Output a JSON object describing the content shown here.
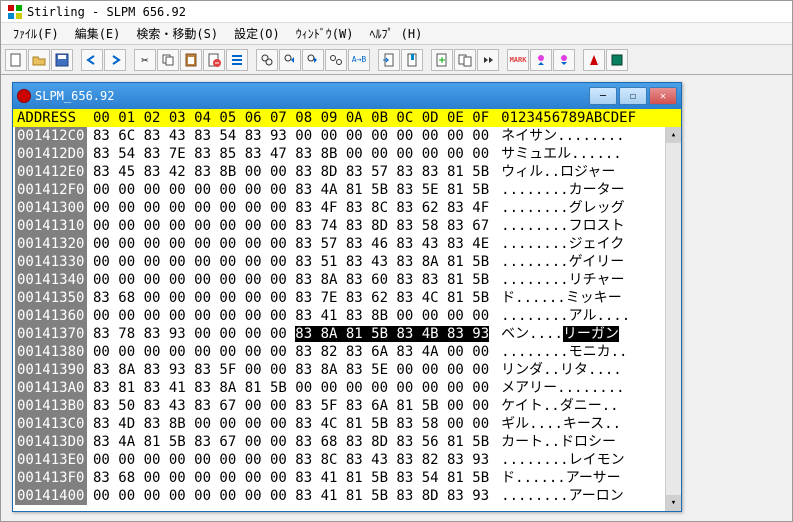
{
  "app": {
    "title": "Stirling - SLPM 656.92"
  },
  "menu": {
    "file": "ﾌｧｲﾙ(F)",
    "edit": "編集(E)",
    "search": "検索・移動(S)",
    "settings": "設定(O)",
    "window": "ｳｨﾝﾄﾞｳ(W)",
    "help": "ﾍﾙﾌﾟ (H)"
  },
  "doc": {
    "title": "SLPM_656.92"
  },
  "header": {
    "addr": "ADDRESS",
    "cols": "00 01 02 03 04 05 06 07 08 09 0A 0B 0C 0D 0E 0F",
    "asc": "0123456789ABCDEF"
  },
  "rows": [
    {
      "a": "001412C0",
      "h": "83 6C 83 43 83 54 83 93 00 00 00 00 00 00 00 00",
      "t": "ネイサン........"
    },
    {
      "a": "001412D0",
      "h": "83 54 83 7E 83 85 83 47 83 8B 00 00 00 00 00 00",
      "t": "サミュエル......"
    },
    {
      "a": "001412E0",
      "h": "83 45 83 42 83 8B 00 00 83 8D 83 57 83 83 81 5B",
      "t": "ウィル..ロジャー"
    },
    {
      "a": "001412F0",
      "h": "00 00 00 00 00 00 00 00 83 4A 81 5B 83 5E 81 5B",
      "t": "........カーター"
    },
    {
      "a": "00141300",
      "h": "00 00 00 00 00 00 00 00 83 4F 83 8C 83 62 83 4F",
      "t": "........グレッグ"
    },
    {
      "a": "00141310",
      "h": "00 00 00 00 00 00 00 00 83 74 83 8D 83 58 83 67",
      "t": "........フロスト"
    },
    {
      "a": "00141320",
      "h": "00 00 00 00 00 00 00 00 83 57 83 46 83 43 83 4E",
      "t": "........ジェイク"
    },
    {
      "a": "00141330",
      "h": "00 00 00 00 00 00 00 00 83 51 83 43 83 8A 81 5B",
      "t": "........ゲイリー"
    },
    {
      "a": "00141340",
      "h": "00 00 00 00 00 00 00 00 83 8A 83 60 83 83 81 5B",
      "t": "........リチャー"
    },
    {
      "a": "00141350",
      "h": "83 68 00 00 00 00 00 00 83 7E 83 62 83 4C 81 5B",
      "t": "ド......ミッキー"
    },
    {
      "a": "00141360",
      "h": "00 00 00 00 00 00 00 00 83 41 83 8B 00 00 00 00",
      "t": "........アル...."
    },
    {
      "a": "00141370",
      "h": "83 78 83 93 00 00 00 00 ",
      "sel": "83 8A 81 5B 83 4B 83 93",
      "t": "ベン....",
      "tsel": "リーガン"
    },
    {
      "a": "00141380",
      "h": "00 00 00 00 00 00 00 00 83 82 83 6A 83 4A 00 00",
      "t": "........モニカ.."
    },
    {
      "a": "00141390",
      "h": "83 8A 83 93 83 5F 00 00 83 8A 83 5E 00 00 00 00",
      "t": "リンダ..リタ...."
    },
    {
      "a": "001413A0",
      "h": "83 81 83 41 83 8A 81 5B 00 00 00 00 00 00 00 00",
      "t": "メアリー........"
    },
    {
      "a": "001413B0",
      "h": "83 50 83 43 83 67 00 00 83 5F 83 6A 81 5B 00 00",
      "t": "ケイト..ダニー.."
    },
    {
      "a": "001413C0",
      "h": "83 4D 83 8B 00 00 00 00 83 4C 81 5B 83 58 00 00",
      "t": "ギル....キース.."
    },
    {
      "a": "001413D0",
      "h": "83 4A 81 5B 83 67 00 00 83 68 83 8D 83 56 81 5B",
      "t": "カート..ドロシー"
    },
    {
      "a": "001413E0",
      "h": "00 00 00 00 00 00 00 00 83 8C 83 43 83 82 83 93",
      "t": "........レイモン"
    },
    {
      "a": "001413F0",
      "h": "83 68 00 00 00 00 00 00 83 41 81 5B 83 54 81 5B",
      "t": "ド......アーサー"
    },
    {
      "a": "00141400",
      "h": "00 00 00 00 00 00 00 00 83 41 81 5B 83 8D 83 93",
      "t": "........アーロン"
    }
  ]
}
